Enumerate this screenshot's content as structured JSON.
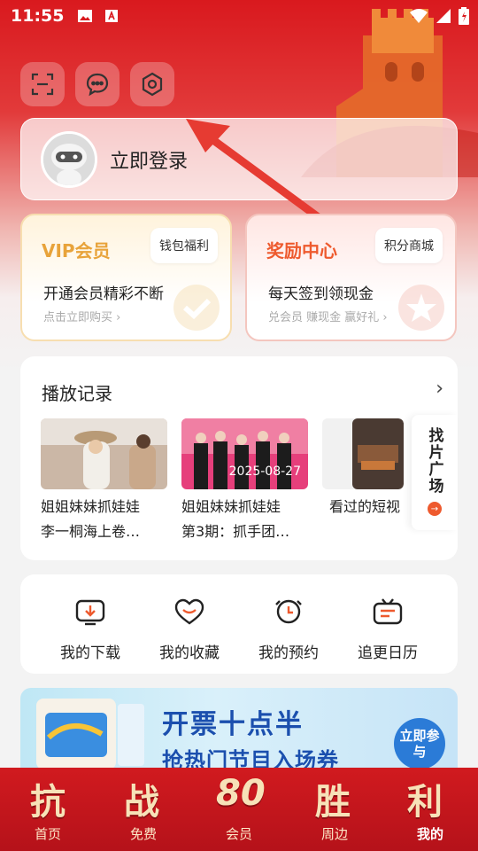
{
  "status_bar": {
    "time": "11:55"
  },
  "login": {
    "label": "立即登录"
  },
  "vip": {
    "title": "VIP会员",
    "chip": "钱包福利",
    "desc": "开通会员精彩不断",
    "sub": "点击立即购买 ›"
  },
  "reward": {
    "title": "奖励中心",
    "chip": "积分商城",
    "desc": "每天签到领现金",
    "sub": "兑会员 赚现金 赢好礼 ›"
  },
  "history": {
    "title": "播放记录",
    "items": [
      {
        "line1": "姐姐妹妹抓娃娃",
        "line2": "李一桐海上卷…"
      },
      {
        "line1": "姐姐妹妹抓娃娃",
        "line2": "第3期：抓手团…",
        "date": "2025-08-27"
      },
      {
        "line1": "看过的短视"
      }
    ],
    "find": "找片广场"
  },
  "shortcuts": [
    {
      "label": "我的下载",
      "icon": "download-icon"
    },
    {
      "label": "我的收藏",
      "icon": "heart-icon"
    },
    {
      "label": "我的预约",
      "icon": "alarm-icon"
    },
    {
      "label": "追更日历",
      "icon": "tv-calendar-icon"
    }
  ],
  "banner": {
    "main": "开票十点半",
    "sub": "抢热门节目入场券",
    "join": "立即参与"
  },
  "tabbar": {
    "big": [
      "抗",
      "战",
      "80",
      "胜",
      "利"
    ],
    "labels": [
      "首页",
      "免费",
      "会员",
      "周边",
      "我的"
    ]
  },
  "colors": {
    "brand_red": "#d9191e",
    "vip_gold": "#e8a33a",
    "reward_orange": "#ee5a2e"
  }
}
